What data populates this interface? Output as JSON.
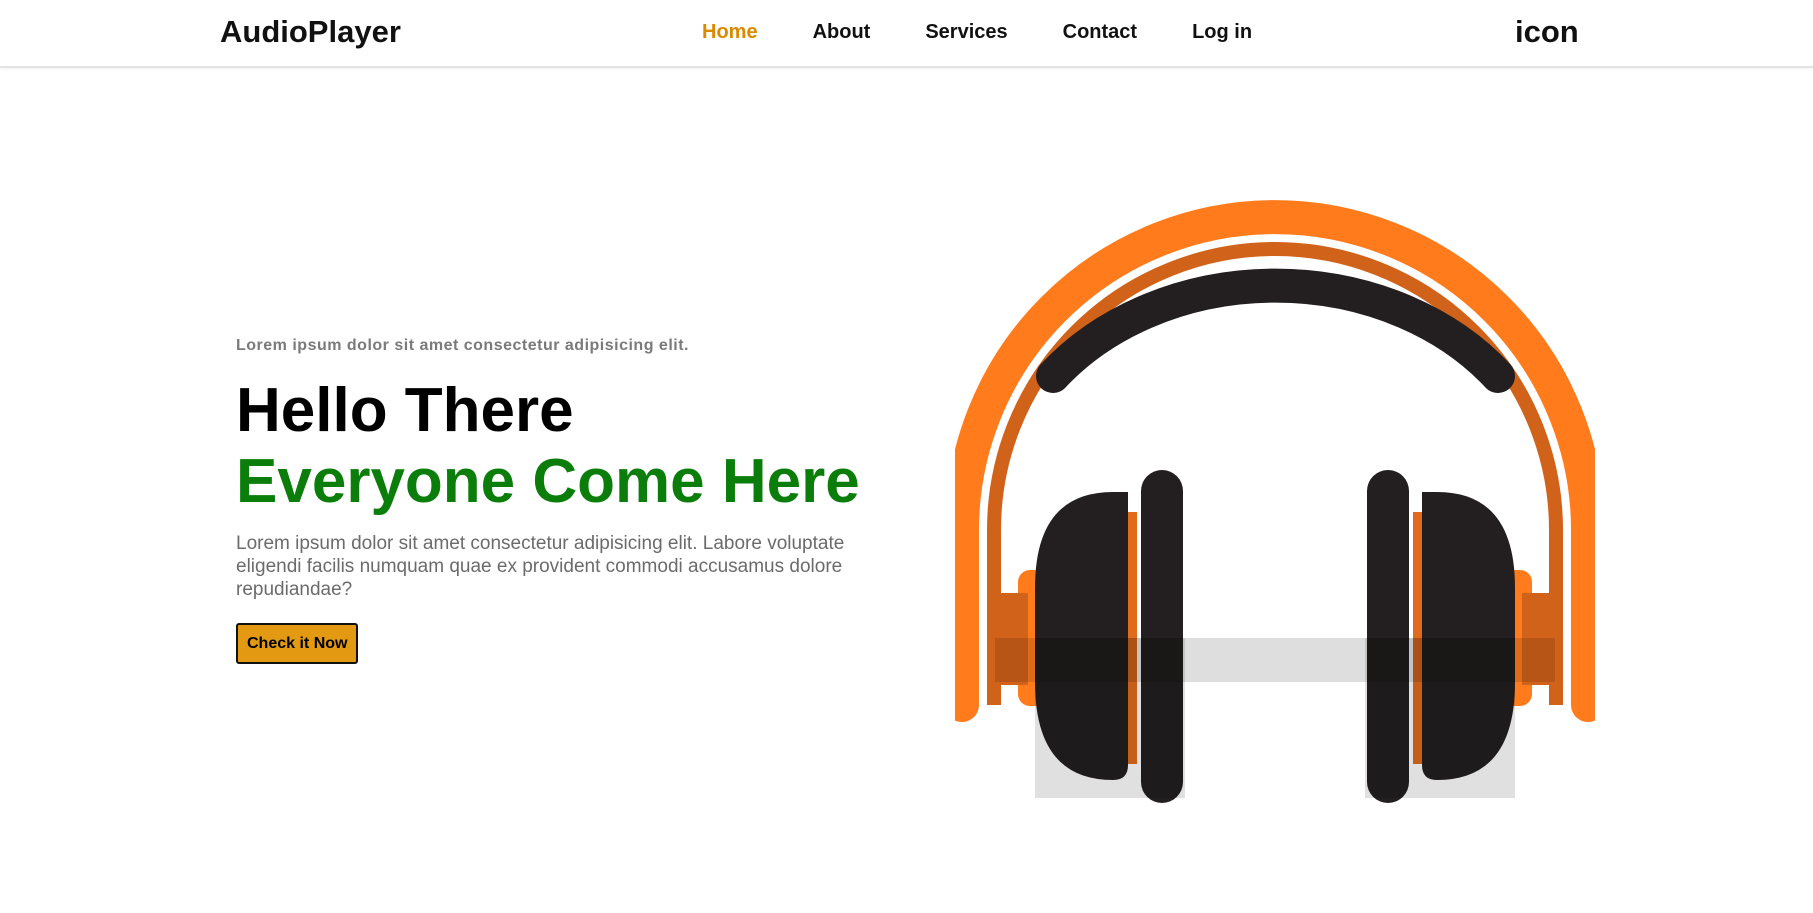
{
  "navbar": {
    "brand": "AudioPlayer",
    "links": [
      {
        "label": "Home",
        "active": true
      },
      {
        "label": "About",
        "active": false
      },
      {
        "label": "Services",
        "active": false
      },
      {
        "label": "Contact",
        "active": false
      },
      {
        "label": "Log in",
        "active": false
      }
    ],
    "icon_text": "icon",
    "active_color": "#d98a00"
  },
  "hero": {
    "eyebrow": "Lorem ipsum dolor sit amet consectetur adipisicing elit.",
    "title_line1": "Hello There",
    "title_line2": "Everyone Come Here",
    "body": "Lorem ipsum dolor sit amet consectetur adipisicing elit. Labore voluptate eligendi facilis numquam quae ex provident commodi accusamus dolore repudiandae?",
    "cta_label": "Check it Now",
    "colors": {
      "title_accent": "#0a7d0a",
      "cta_background": "#e39a12"
    },
    "illustration": "headphones-icon"
  }
}
